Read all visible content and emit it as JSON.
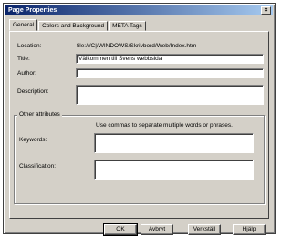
{
  "window": {
    "title": "Page Properties",
    "close_symbol": "×"
  },
  "tabs": [
    {
      "label": "General"
    },
    {
      "label": "Colors and Background"
    },
    {
      "label": "META Tags"
    }
  ],
  "general": {
    "location_label": "Location:",
    "location_value": "file:///C|/WINDOWS/Skrivbord/Web/Index.htm",
    "title_label": "Title:",
    "title_value": "Välkommen till Svens webbsida",
    "author_label": "Author:",
    "author_value": "",
    "description_label": "Description:",
    "description_value": ""
  },
  "other_attributes": {
    "legend": "Other attributes",
    "hint": "Use commas to separate multiple words or phrases.",
    "keywords_label": "Keywords:",
    "keywords_value": "",
    "classification_label": "Classification:",
    "classification_value": ""
  },
  "buttons": {
    "ok": "OK",
    "cancel": "Avbryt",
    "apply": "Verkställ",
    "help": "Hjälp"
  }
}
